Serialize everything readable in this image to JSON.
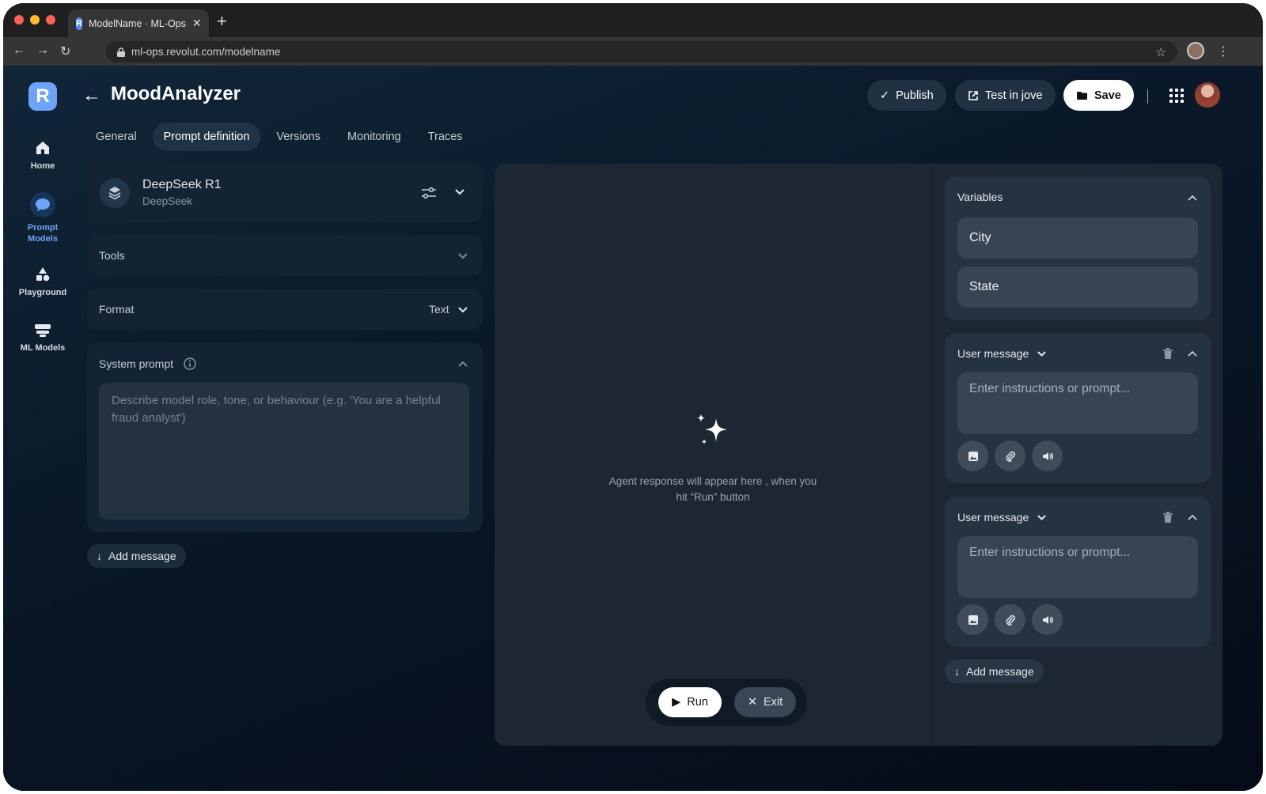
{
  "browser": {
    "tab_title": "ModelName · ML-Ops",
    "tab_favicon": "R",
    "url": "ml-ops.revolut.com/modelname"
  },
  "sidebar": {
    "logo": "R",
    "items": [
      {
        "label": "Home",
        "icon": "home-icon"
      },
      {
        "label": "Prompt Models",
        "icon": "chat-bubble-icon",
        "active": true
      },
      {
        "label": "Playground",
        "icon": "shapes-icon"
      },
      {
        "label": "ML Models",
        "icon": "server-icon"
      }
    ]
  },
  "header": {
    "title": "MoodAnalyzer",
    "publish_label": "Publish",
    "test_label": "Test in jove",
    "save_label": "Save"
  },
  "tabs": [
    "General",
    "Prompt definition",
    "Versions",
    "Monitoring",
    "Traces"
  ],
  "active_tab": "Prompt definition",
  "model": {
    "name": "DeepSeek R1",
    "provider": "DeepSeek"
  },
  "tools": {
    "label": "Tools"
  },
  "format": {
    "label": "Format",
    "value": "Text"
  },
  "system_prompt": {
    "label": "System prompt",
    "placeholder": "Describe model role, tone, or behaviour (e.g. 'You are a helpful fraud analyst')"
  },
  "left_add_message": "Add message",
  "center": {
    "response_line1": "Agent response will appear here , when you",
    "response_line2": "hit “Run” button",
    "run_label": "Run",
    "exit_label": "Exit"
  },
  "variables": {
    "title": "Variables",
    "items": [
      "City",
      "State"
    ]
  },
  "user_messages": [
    {
      "role": "User message",
      "placeholder": "Enter instructions or prompt..."
    },
    {
      "role": "User message",
      "placeholder": "Enter instructions or prompt..."
    }
  ],
  "right_add_message": "Add message",
  "colors": {
    "accent": "#6ea4f7",
    "panel": "#1c2733",
    "card": "#253240",
    "background": "#0b1624"
  }
}
